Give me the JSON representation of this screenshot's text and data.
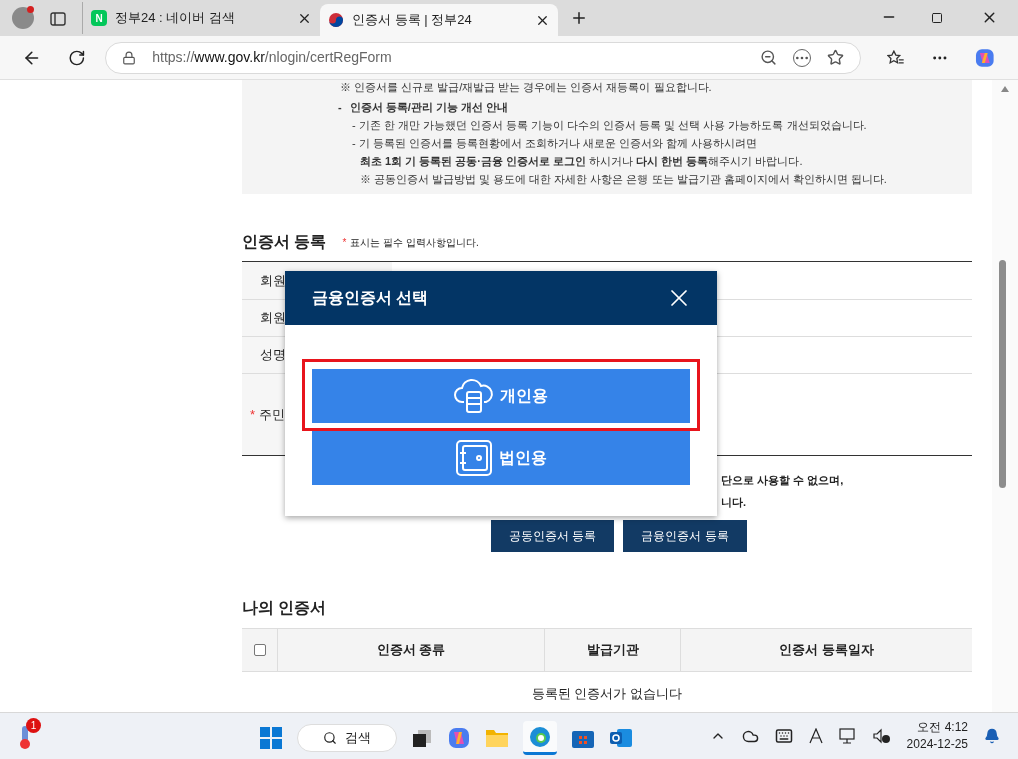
{
  "browser": {
    "tabs": [
      {
        "title": "정부24 : 네이버 검색",
        "selected": false,
        "kind": "naver",
        "badge": "N"
      },
      {
        "title": "인증서 등록 | 정부24",
        "selected": true,
        "kind": "gov"
      }
    ],
    "url": {
      "scheme": "https://",
      "host": "www.gov.kr",
      "path": "/nlogin/certRegForm"
    }
  },
  "notice": [
    {
      "kind": "note",
      "text": "※ 인증서를 신규로 발급/재발급 받는 경우에는 인증서 재등록이 필요합니다."
    },
    {
      "kind": "heading",
      "bullet": "-",
      "text": "인증서 등록/관리 기능 개선 안내"
    },
    {
      "kind": "item",
      "text": "- 기존 한 개만 가능했던 인증서 등록 기능이 다수의 인증서 등록 및 선택 사용 가능하도록 개선되었습니다."
    },
    {
      "kind": "item",
      "text": "- 기 등록된 인증서를 등록현황에서 조회하거나 새로운 인증서와 함께 사용하시려면"
    },
    {
      "kind": "sub",
      "text": "**최초 1회 기 등록된 공동·금융 인증서로 로그인** 하시거나 **다시 한번 등록**해주시기 바랍니다."
    },
    {
      "kind": "sub",
      "text": "※ 공동인증서 발급방법 및 용도에 대한 자세한 사항은 은행 또는 발급기관 홈페이지에서 확인하시면 됩니다."
    }
  ],
  "registration": {
    "title": "인증서 등록",
    "required_mark": "*",
    "required_note": "표시는 필수 입력사항입니다.",
    "rows": [
      {
        "label": "회원",
        "required": false
      },
      {
        "label": "회원",
        "required": false
      },
      {
        "label": "성명",
        "required": false
      },
      {
        "label": "주민",
        "required": true
      }
    ],
    "notes": [
      "단으로 사용할 수 없으며,",
      "니다."
    ],
    "buttons": [
      "공동인증서 등록",
      "금융인증서 등록"
    ]
  },
  "modal": {
    "title": "금융인증서 선택",
    "options": [
      {
        "label": "개인용",
        "kind": "personal",
        "highlighted": true
      },
      {
        "label": "법인용",
        "kind": "corporate",
        "highlighted": false
      }
    ]
  },
  "my_certificates": {
    "title": "나의 인증서",
    "select_all": {
      "checked": false
    },
    "columns": [
      "인증서 종류",
      "발급기관",
      "인증서 등록일자"
    ],
    "empty_text": "등록된 인증서가 없습니다"
  },
  "taskbar": {
    "search": "검색",
    "weather_badge": "1",
    "time": "오전 4:12",
    "date": "2024-12-25"
  }
}
